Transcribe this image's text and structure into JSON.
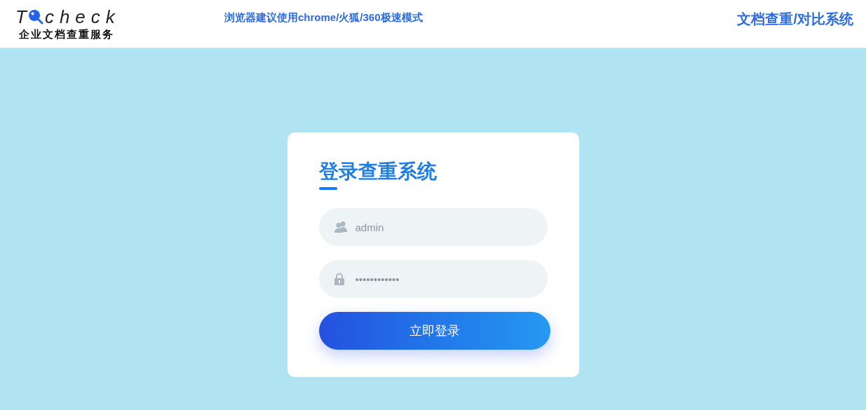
{
  "header": {
    "logo": {
      "first_letter": "T",
      "rest": "check",
      "subtitle": "企业文档查重服务"
    },
    "notice": "浏览器建议使用chrome/火狐/360极速模式",
    "system_title": "文档查重/对比系统"
  },
  "login": {
    "title": "登录查重系统",
    "fields": [
      {
        "kind": "user",
        "value": "admin"
      },
      {
        "kind": "password",
        "value": "••••••••••••"
      }
    ],
    "button": "立即登录"
  }
}
